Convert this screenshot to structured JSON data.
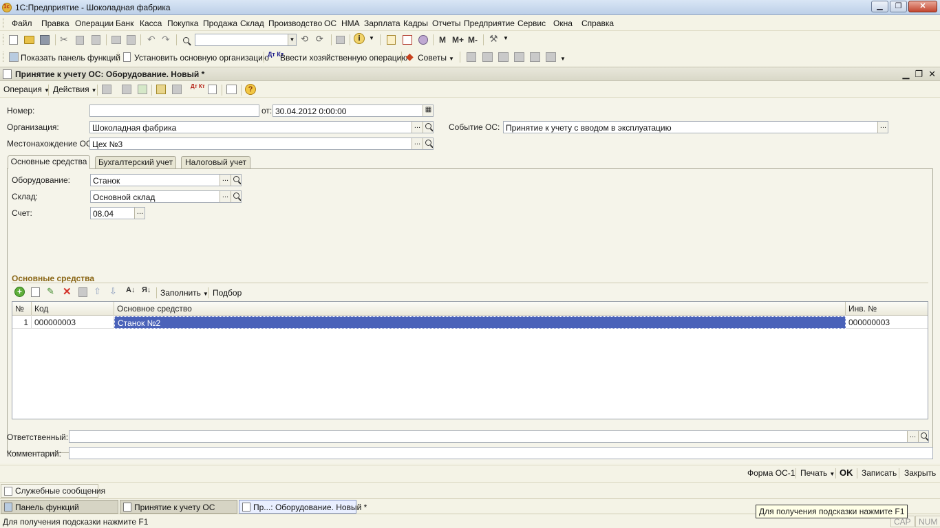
{
  "window": {
    "title": "1С:Предприятие - Шоколадная фабрика",
    "minimize": "▁",
    "maximize": "❐",
    "close": "✕"
  },
  "menu": [
    "Файл",
    "Правка",
    "Операции",
    "Банк",
    "Касса",
    "Покупка",
    "Продажа",
    "Склад",
    "Производство",
    "ОС",
    "НМА",
    "Зарплата",
    "Кадры",
    "Отчеты",
    "Предприятие",
    "Сервис",
    "Окна",
    "Справка"
  ],
  "toolbar2": {
    "show_panel": "Показать панель функций",
    "set_org": "Установить основную организацию",
    "enter_op": "Ввести хозяйственную операцию",
    "tips": "Советы",
    "m": "M",
    "mplus": "M+",
    "mminus": "M-",
    "dt_kt": "Дт Кт"
  },
  "document": {
    "title": "Принятие к учету ОС: Оборудование. Новый *",
    "operation": "Операция",
    "actions": "Действия"
  },
  "form": {
    "number_label": "Номер:",
    "number_value": "",
    "date_label": "от:",
    "date_value": "30.04.2012  0:00:00",
    "org_label": "Организация:",
    "org_value": "Шоколадная фабрика",
    "event_label": "Событие ОС:",
    "event_value": "Принятие к учету с вводом в эксплуатацию",
    "location_label": "Местонахождение ОС:",
    "location_value": "Цех №3",
    "tabs": [
      "Основные средства",
      "Бухгалтерский учет",
      "Налоговый учет"
    ],
    "equipment_label": "Оборудование:",
    "equipment_value": "Станок",
    "warehouse_label": "Склад:",
    "warehouse_value": "Основной склад",
    "account_label": "Счет:",
    "account_value": "08.04",
    "section_title": "Основные средства",
    "fill": "Заполнить",
    "pick": "Подбор",
    "table": {
      "headers": [
        "№",
        "Код",
        "Основное средство",
        "Инв. №"
      ],
      "rows": [
        {
          "num": "1",
          "code": "000000003",
          "name": "Станок №2",
          "inv": "000000003"
        }
      ]
    },
    "responsible_label": "Ответственный:",
    "responsible_value": "",
    "comment_label": "Комментарий:",
    "comment_value": "",
    "ellipsis": "..."
  },
  "bottom": {
    "form_os1": "Форма ОС-1",
    "print": "Печать",
    "ok": "OK",
    "save": "Записать",
    "close": "Закрыть"
  },
  "service": {
    "messages": "Служебные сообщения"
  },
  "tasks": [
    "Панель функций",
    "Принятие к учету ОС",
    "Пр...: Оборудование. Новый *"
  ],
  "status": {
    "hint": "Для получения подсказки нажмите F1",
    "cap": "CAP",
    "num": "NUM"
  },
  "tooltip": "Для получения подсказки нажмите F1"
}
